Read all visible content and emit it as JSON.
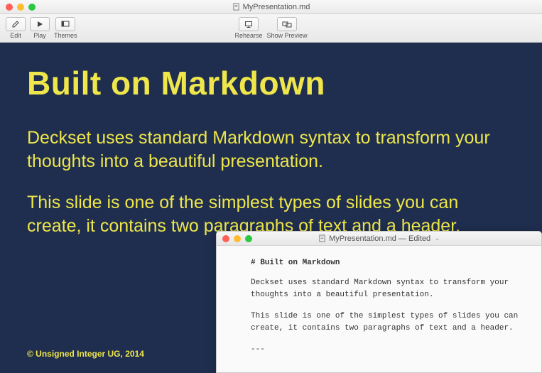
{
  "main": {
    "title": "MyPresentation.md",
    "toolbar": {
      "edit": "Edit",
      "play": "Play",
      "themes": "Themes",
      "rehearse": "Rehearse",
      "show_preview": "Show Preview"
    },
    "slide": {
      "heading": "Built on Markdown",
      "para1": "Deckset uses standard Markdown syntax to transform your thoughts into a beautiful presentation.",
      "para2": "This slide is one of the simplest types of slides you can create, it contains two paragraphs of text and a header.",
      "footer": "© Unsigned Integer UG, 2014"
    }
  },
  "editor": {
    "title": "MyPresentation.md — Edited",
    "content": {
      "h1": "# Built on Markdown",
      "p1": "Deckset uses standard Markdown syntax to transform your thoughts into a beautiful presentation.",
      "p2": "This slide is one of the simplest types of slides you can create, it contains two paragraphs of text and a header.",
      "hr": "---"
    }
  }
}
